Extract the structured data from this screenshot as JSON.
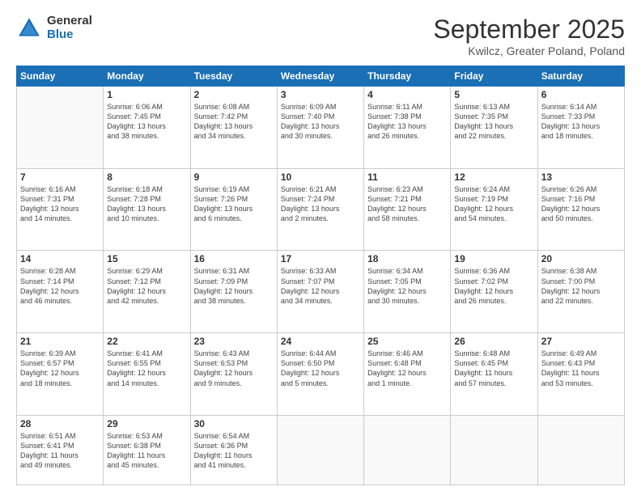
{
  "logo": {
    "general": "General",
    "blue": "Blue"
  },
  "title": {
    "month": "September 2025",
    "location": "Kwilcz, Greater Poland, Poland"
  },
  "headers": [
    "Sunday",
    "Monday",
    "Tuesday",
    "Wednesday",
    "Thursday",
    "Friday",
    "Saturday"
  ],
  "weeks": [
    [
      {
        "day": "",
        "info": ""
      },
      {
        "day": "1",
        "info": "Sunrise: 6:06 AM\nSunset: 7:45 PM\nDaylight: 13 hours\nand 38 minutes."
      },
      {
        "day": "2",
        "info": "Sunrise: 6:08 AM\nSunset: 7:42 PM\nDaylight: 13 hours\nand 34 minutes."
      },
      {
        "day": "3",
        "info": "Sunrise: 6:09 AM\nSunset: 7:40 PM\nDaylight: 13 hours\nand 30 minutes."
      },
      {
        "day": "4",
        "info": "Sunrise: 6:11 AM\nSunset: 7:38 PM\nDaylight: 13 hours\nand 26 minutes."
      },
      {
        "day": "5",
        "info": "Sunrise: 6:13 AM\nSunset: 7:35 PM\nDaylight: 13 hours\nand 22 minutes."
      },
      {
        "day": "6",
        "info": "Sunrise: 6:14 AM\nSunset: 7:33 PM\nDaylight: 13 hours\nand 18 minutes."
      }
    ],
    [
      {
        "day": "7",
        "info": "Sunrise: 6:16 AM\nSunset: 7:31 PM\nDaylight: 13 hours\nand 14 minutes."
      },
      {
        "day": "8",
        "info": "Sunrise: 6:18 AM\nSunset: 7:28 PM\nDaylight: 13 hours\nand 10 minutes."
      },
      {
        "day": "9",
        "info": "Sunrise: 6:19 AM\nSunset: 7:26 PM\nDaylight: 13 hours\nand 6 minutes."
      },
      {
        "day": "10",
        "info": "Sunrise: 6:21 AM\nSunset: 7:24 PM\nDaylight: 13 hours\nand 2 minutes."
      },
      {
        "day": "11",
        "info": "Sunrise: 6:23 AM\nSunset: 7:21 PM\nDaylight: 12 hours\nand 58 minutes."
      },
      {
        "day": "12",
        "info": "Sunrise: 6:24 AM\nSunset: 7:19 PM\nDaylight: 12 hours\nand 54 minutes."
      },
      {
        "day": "13",
        "info": "Sunrise: 6:26 AM\nSunset: 7:16 PM\nDaylight: 12 hours\nand 50 minutes."
      }
    ],
    [
      {
        "day": "14",
        "info": "Sunrise: 6:28 AM\nSunset: 7:14 PM\nDaylight: 12 hours\nand 46 minutes."
      },
      {
        "day": "15",
        "info": "Sunrise: 6:29 AM\nSunset: 7:12 PM\nDaylight: 12 hours\nand 42 minutes."
      },
      {
        "day": "16",
        "info": "Sunrise: 6:31 AM\nSunset: 7:09 PM\nDaylight: 12 hours\nand 38 minutes."
      },
      {
        "day": "17",
        "info": "Sunrise: 6:33 AM\nSunset: 7:07 PM\nDaylight: 12 hours\nand 34 minutes."
      },
      {
        "day": "18",
        "info": "Sunrise: 6:34 AM\nSunset: 7:05 PM\nDaylight: 12 hours\nand 30 minutes."
      },
      {
        "day": "19",
        "info": "Sunrise: 6:36 AM\nSunset: 7:02 PM\nDaylight: 12 hours\nand 26 minutes."
      },
      {
        "day": "20",
        "info": "Sunrise: 6:38 AM\nSunset: 7:00 PM\nDaylight: 12 hours\nand 22 minutes."
      }
    ],
    [
      {
        "day": "21",
        "info": "Sunrise: 6:39 AM\nSunset: 6:57 PM\nDaylight: 12 hours\nand 18 minutes."
      },
      {
        "day": "22",
        "info": "Sunrise: 6:41 AM\nSunset: 6:55 PM\nDaylight: 12 hours\nand 14 minutes."
      },
      {
        "day": "23",
        "info": "Sunrise: 6:43 AM\nSunset: 6:53 PM\nDaylight: 12 hours\nand 9 minutes."
      },
      {
        "day": "24",
        "info": "Sunrise: 6:44 AM\nSunset: 6:50 PM\nDaylight: 12 hours\nand 5 minutes."
      },
      {
        "day": "25",
        "info": "Sunrise: 6:46 AM\nSunset: 6:48 PM\nDaylight: 12 hours\nand 1 minute."
      },
      {
        "day": "26",
        "info": "Sunrise: 6:48 AM\nSunset: 6:45 PM\nDaylight: 11 hours\nand 57 minutes."
      },
      {
        "day": "27",
        "info": "Sunrise: 6:49 AM\nSunset: 6:43 PM\nDaylight: 11 hours\nand 53 minutes."
      }
    ],
    [
      {
        "day": "28",
        "info": "Sunrise: 6:51 AM\nSunset: 6:41 PM\nDaylight: 11 hours\nand 49 minutes."
      },
      {
        "day": "29",
        "info": "Sunrise: 6:53 AM\nSunset: 6:38 PM\nDaylight: 11 hours\nand 45 minutes."
      },
      {
        "day": "30",
        "info": "Sunrise: 6:54 AM\nSunset: 6:36 PM\nDaylight: 11 hours\nand 41 minutes."
      },
      {
        "day": "",
        "info": ""
      },
      {
        "day": "",
        "info": ""
      },
      {
        "day": "",
        "info": ""
      },
      {
        "day": "",
        "info": ""
      }
    ]
  ]
}
